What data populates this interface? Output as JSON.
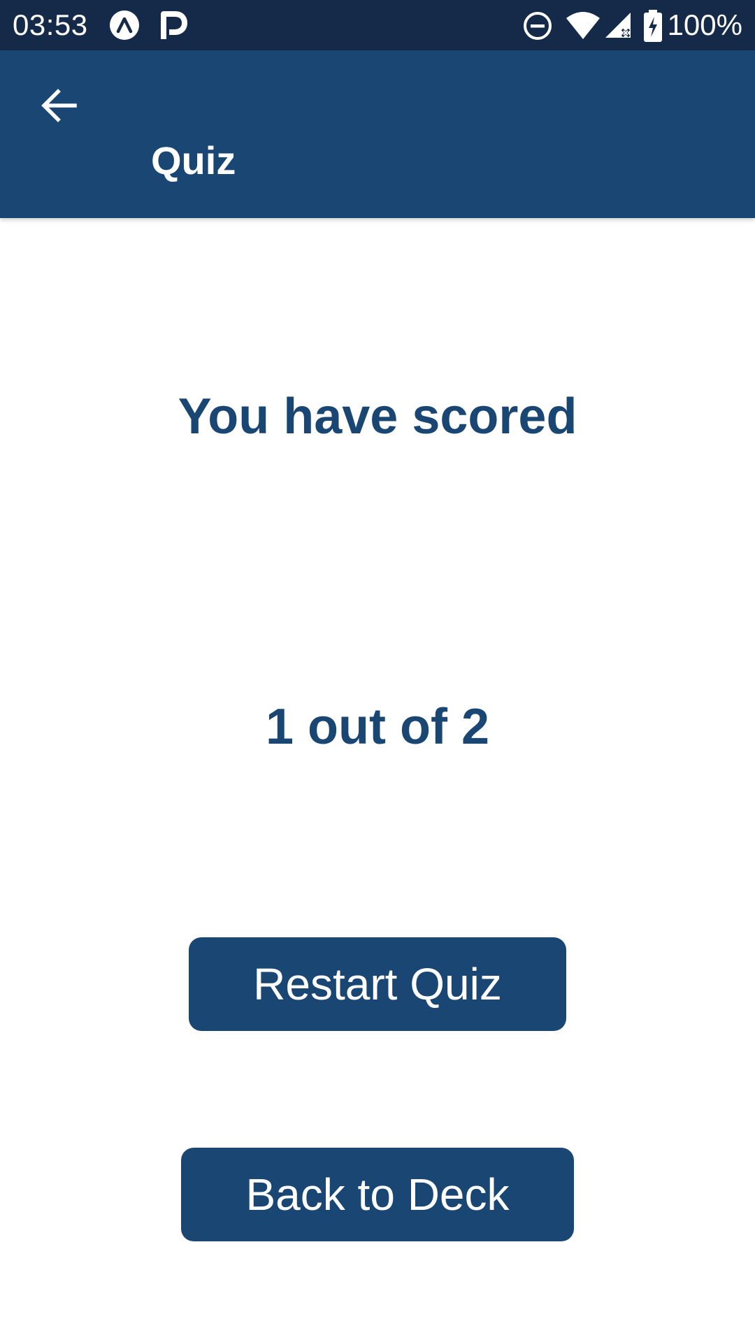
{
  "status_bar": {
    "time": "03:53",
    "battery_text": "100%",
    "icons": [
      "expo-icon",
      "p-app-icon",
      "do-not-disturb-icon",
      "wifi-icon",
      "cell-signal-icon",
      "battery-charging-icon"
    ]
  },
  "app_bar": {
    "title": "Quiz",
    "back_icon": "arrow-back-icon"
  },
  "result": {
    "heading": "You have scored",
    "score": "1 out of 2"
  },
  "actions": {
    "restart_label": "Restart Quiz",
    "back_label": "Back to Deck"
  },
  "colors": {
    "status_bar": "#142a48",
    "primary": "#1a4674",
    "background": "#ffffff",
    "on_primary": "#ffffff"
  }
}
